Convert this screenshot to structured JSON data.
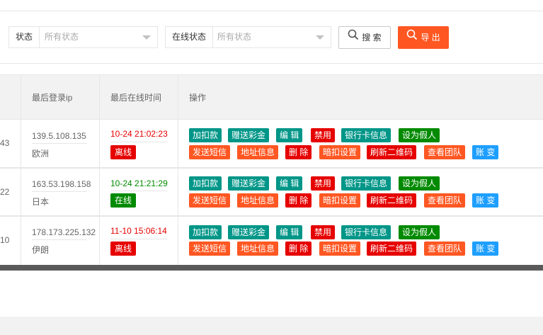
{
  "filters": {
    "status": {
      "label": "状态",
      "value": "所有状态"
    },
    "online_status": {
      "label": "在线状态",
      "value": "所有状态"
    }
  },
  "toolbar": {
    "search_label": "搜 索",
    "export_label": "导 出",
    "search_icon": "search-icon",
    "export_icon": "search-icon"
  },
  "table": {
    "headers": {
      "last_login_ip": "最后登录ip",
      "last_online_time": "最后在线时间",
      "actions": "操作"
    },
    "rows": [
      {
        "num": "43",
        "ip": "139.5.108.135",
        "location": "欧洲",
        "time": "10-24 21:02:23",
        "status": "离线",
        "time_color": "#e60000",
        "status_color": "#e60000"
      },
      {
        "num": "22",
        "ip": "163.53.198.158",
        "location": "日本",
        "time": "10-24 21:21:29",
        "status": "在线",
        "time_color": "#008a00",
        "status_color": "#008a00"
      },
      {
        "num": "10",
        "ip": "178.173.225.132",
        "location": "伊朗",
        "time": "11-10 15:06:14",
        "status": "离线",
        "time_color": "#e60000",
        "status_color": "#e60000"
      }
    ],
    "actions_row1": [
      "加扣款",
      "赠送彩金",
      "编 辑",
      "禁用",
      "银行卡信息",
      "设为假人"
    ],
    "actions_row2": [
      "发送短信",
      "地址信息",
      "删 除",
      "暗扣设置",
      "刷新二维码",
      "查看团队",
      "账 变"
    ]
  },
  "colors": {
    "teal": "#009688",
    "red": "#e60000",
    "green": "#008a00",
    "orange": "#ff5722",
    "blue": "#1e9fff"
  }
}
